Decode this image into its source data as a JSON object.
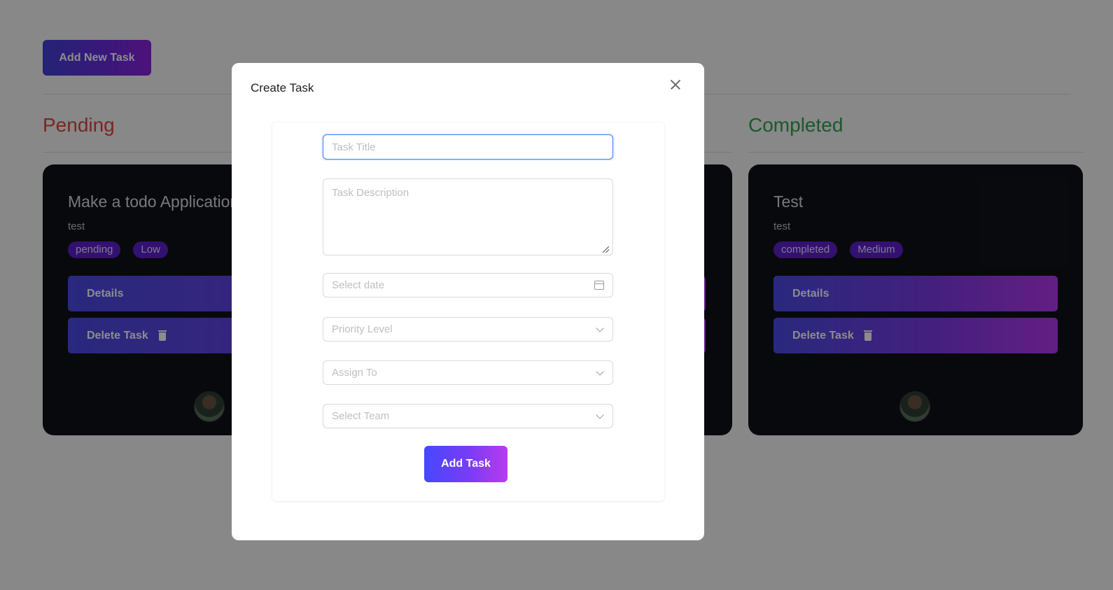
{
  "header": {
    "add_button_label": "Add New Task"
  },
  "columns": {
    "pending": {
      "title": "Pending",
      "title_color": "#e0463e",
      "card": {
        "title": "Make a todo Application",
        "description": "test",
        "status_tag": "pending",
        "priority_tag": "Low",
        "details_label": "Details",
        "delete_label": "Delete Task"
      }
    },
    "completed": {
      "title": "Completed",
      "title_color": "#2ea44f",
      "card": {
        "title": "Test",
        "description": "test",
        "status_tag": "completed",
        "priority_tag": "Medium",
        "details_label": "Details",
        "delete_label": "Delete Task"
      }
    }
  },
  "modal": {
    "title": "Create Task",
    "close_icon": "close-icon",
    "form": {
      "task_title_placeholder": "Task Title",
      "task_description_placeholder": "Task Description",
      "date_placeholder": "Select date",
      "priority_placeholder": "Priority Level",
      "assign_placeholder": "Assign To",
      "team_placeholder": "Select Team",
      "submit_label": "Add Task"
    }
  },
  "icons": {
    "trash": "trash-icon",
    "calendar": "calendar-icon",
    "chevron": "chevron-down-icon"
  },
  "colors": {
    "accent_gradient_start": "#4648ff",
    "accent_gradient_end": "#b83bef",
    "tag_bg": "#5e1fcf",
    "card_bg": "#0f1217"
  }
}
